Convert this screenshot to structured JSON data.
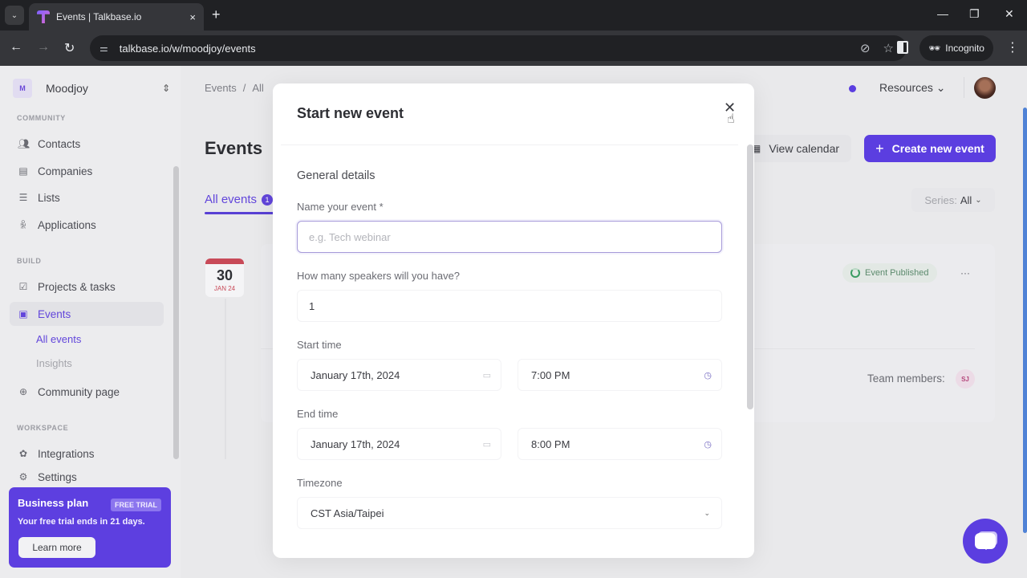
{
  "browser": {
    "tab_title": "Events | Talkbase.io",
    "tab_close": "×",
    "new_tab": "+",
    "url": "talkbase.io/w/moodjoy/events",
    "incognito_label": "Incognito",
    "window_controls": {
      "minimize": "—",
      "restore": "❐",
      "close": "✕"
    },
    "nav": {
      "back": "←",
      "forward": "→",
      "reload": "↻"
    }
  },
  "workspace": {
    "initial": "M",
    "name": "Moodjoy",
    "switch_icon": "⇕"
  },
  "sidebar": {
    "sections": [
      {
        "label": "COMMUNITY"
      },
      {
        "label": "BUILD"
      },
      {
        "label": "WORKSPACE"
      }
    ],
    "items": [
      {
        "label": "Contacts",
        "icon": "👥︎"
      },
      {
        "label": "Companies",
        "icon": "▤"
      },
      {
        "label": "Lists",
        "icon": "☰"
      },
      {
        "label": "Applications",
        "icon": "ꆜ"
      },
      {
        "label": "Projects & tasks",
        "icon": "☑"
      },
      {
        "label": "Events",
        "icon": "▣",
        "active": true
      },
      {
        "label": "Community page",
        "icon": "⊕"
      },
      {
        "label": "Integrations",
        "icon": "✿"
      },
      {
        "label": "Settings",
        "icon": "⚙"
      }
    ],
    "sub_items": [
      {
        "label": "All events",
        "active": true
      },
      {
        "label": "Insights"
      }
    ],
    "promo": {
      "title": "Business plan",
      "badge": "FREE TRIAL",
      "text": "Your free trial ends in 21 days.",
      "button": "Learn more"
    }
  },
  "main": {
    "breadcrumb": [
      "Events",
      "All"
    ],
    "breadcrumb_sep": "/",
    "title": "Events",
    "tab_all": "All events",
    "tab_all_badge": "1",
    "resources": "Resources ⌄",
    "view_calendar": "View calendar",
    "create_button": "Create new event",
    "create_icon": "+",
    "series_label": "Series:",
    "series_value": "All",
    "series_chevron": "⌄",
    "event": {
      "day": "30",
      "month": "JAN 24",
      "status": "Event Published",
      "more": "···",
      "team_label": "Team members:",
      "team_initials": "SJ"
    }
  },
  "modal": {
    "title": "Start new event",
    "close": "✕",
    "section": "General details",
    "name_label": "Name your event *",
    "name_placeholder": "e.g. Tech webinar",
    "speakers_label": "How many speakers will you have?",
    "speakers_value": "1",
    "start_label": "Start time",
    "start_date": "January 17th, 2024",
    "start_time": "7:00 PM",
    "end_label": "End time",
    "end_date": "January 17th, 2024",
    "end_time": "8:00 PM",
    "timezone_label": "Timezone",
    "timezone_value": "CST Asia/Taipei",
    "calendar_icon": "▭",
    "clock_icon": "◷",
    "chevron": "⌄"
  },
  "colors": {
    "accent": "#5b3ee0",
    "event_date_red": "#c84a58",
    "published_green": "#3a9c63"
  }
}
